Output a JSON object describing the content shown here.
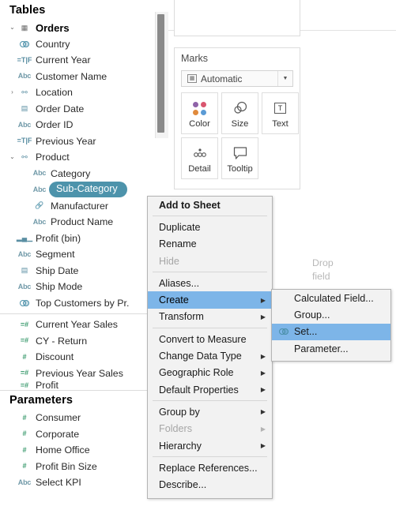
{
  "data_pane": {
    "tables_header": "Tables",
    "parameters_header": "Parameters",
    "table_name": "Orders",
    "fields": [
      {
        "label": "Country",
        "icon": "geo-venn-icon",
        "indent": 1
      },
      {
        "label": "Current Year",
        "icon": "string-calc-icon",
        "indent": 1
      },
      {
        "label": "Customer Name",
        "icon": "abc-icon",
        "indent": 1
      },
      {
        "label": "Location",
        "icon": "hierarchy-icon",
        "indent": 1,
        "twisty": "collapsed"
      },
      {
        "label": "Order Date",
        "icon": "calendar-icon",
        "indent": 1
      },
      {
        "label": "Order ID",
        "icon": "abc-icon",
        "indent": 1
      },
      {
        "label": "Previous Year",
        "icon": "string-calc-icon",
        "indent": 1
      },
      {
        "label": "Product",
        "icon": "hierarchy-icon",
        "indent": 1,
        "twisty": "expanded"
      },
      {
        "label": "Category",
        "icon": "abc-icon",
        "indent": 2
      },
      {
        "label": "Sub-Category",
        "icon": "abc-icon",
        "indent": 2,
        "selected": true
      },
      {
        "label": "Manufacturer",
        "icon": "link-icon",
        "indent": 2
      },
      {
        "label": "Product Name",
        "icon": "abc-icon",
        "indent": 2
      },
      {
        "label": "Profit (bin)",
        "icon": "bin-icon",
        "indent": 1
      },
      {
        "label": "Segment",
        "icon": "abc-icon",
        "indent": 1
      },
      {
        "label": "Ship Date",
        "icon": "calendar-icon",
        "indent": 1
      },
      {
        "label": "Ship Mode",
        "icon": "abc-icon",
        "indent": 1
      },
      {
        "label": "Top Customers by Pr.",
        "icon": "set-venn-icon",
        "indent": 1
      }
    ],
    "measures": [
      {
        "label": "Current Year Sales",
        "icon": "number-calc-icon"
      },
      {
        "label": "CY - Return",
        "icon": "number-calc-icon"
      },
      {
        "label": "Discount",
        "icon": "number-icon"
      },
      {
        "label": "Previous Year Sales",
        "icon": "number-calc-icon"
      },
      {
        "label": "Profit",
        "icon": "number-calc-icon",
        "clipped": true
      }
    ],
    "parameters": [
      {
        "label": "Consumer",
        "icon": "number-icon"
      },
      {
        "label": "Corporate",
        "icon": "number-icon"
      },
      {
        "label": "Home Office",
        "icon": "number-icon"
      },
      {
        "label": "Profit Bin Size",
        "icon": "number-icon"
      },
      {
        "label": "Select KPI",
        "icon": "abc-icon"
      }
    ]
  },
  "marks_card": {
    "title": "Marks",
    "mark_type": "Automatic",
    "buttons": [
      {
        "label": "Color",
        "icon": "color-dots-icon"
      },
      {
        "label": "Size",
        "icon": "size-circles-icon"
      },
      {
        "label": "Text",
        "icon": "text-box-icon"
      },
      {
        "label": "Detail",
        "icon": "detail-dots-icon"
      },
      {
        "label": "Tooltip",
        "icon": "tooltip-bubble-icon"
      }
    ],
    "color_swatches": [
      "#8f63a8",
      "#d9566f",
      "#e08a3c",
      "#5b9bd5"
    ]
  },
  "sheet": {
    "drop_field_label": "Drop\nfield",
    "drop_field_line1": "Drop",
    "drop_field_line2": "field"
  },
  "context_menu": {
    "items": [
      {
        "label": "Add to Sheet",
        "style": "bold"
      },
      {
        "type": "separator"
      },
      {
        "label": "Duplicate"
      },
      {
        "label": "Rename"
      },
      {
        "label": "Hide",
        "style": "disabled"
      },
      {
        "type": "separator"
      },
      {
        "label": "Aliases..."
      },
      {
        "label": "Create",
        "style": "highlighted",
        "submenu": true
      },
      {
        "label": "Transform",
        "submenu": true
      },
      {
        "type": "separator"
      },
      {
        "label": "Convert to Measure"
      },
      {
        "label": "Change Data Type",
        "submenu": true
      },
      {
        "label": "Geographic Role",
        "submenu": true
      },
      {
        "label": "Default Properties",
        "submenu": true
      },
      {
        "type": "separator"
      },
      {
        "label": "Group by",
        "submenu": true
      },
      {
        "label": "Folders",
        "style": "disabled",
        "submenu": true
      },
      {
        "label": "Hierarchy",
        "submenu": true
      },
      {
        "type": "separator"
      },
      {
        "label": "Replace References..."
      },
      {
        "label": "Describe..."
      }
    ]
  },
  "submenu": {
    "items": [
      {
        "label": "Calculated Field...",
        "icon": null
      },
      {
        "label": "Group...",
        "icon": null
      },
      {
        "label": "Set...",
        "icon": "set-venn-icon",
        "style": "highlighted"
      },
      {
        "label": "Parameter...",
        "icon": null
      }
    ]
  },
  "colors": {
    "selection_pill": "#4d93ab",
    "menu_highlight": "#7db5e8",
    "menu_background": "#f2f2f2",
    "dimension_icon": "#5b8fa3",
    "measure_icon": "#3a9a6d"
  }
}
